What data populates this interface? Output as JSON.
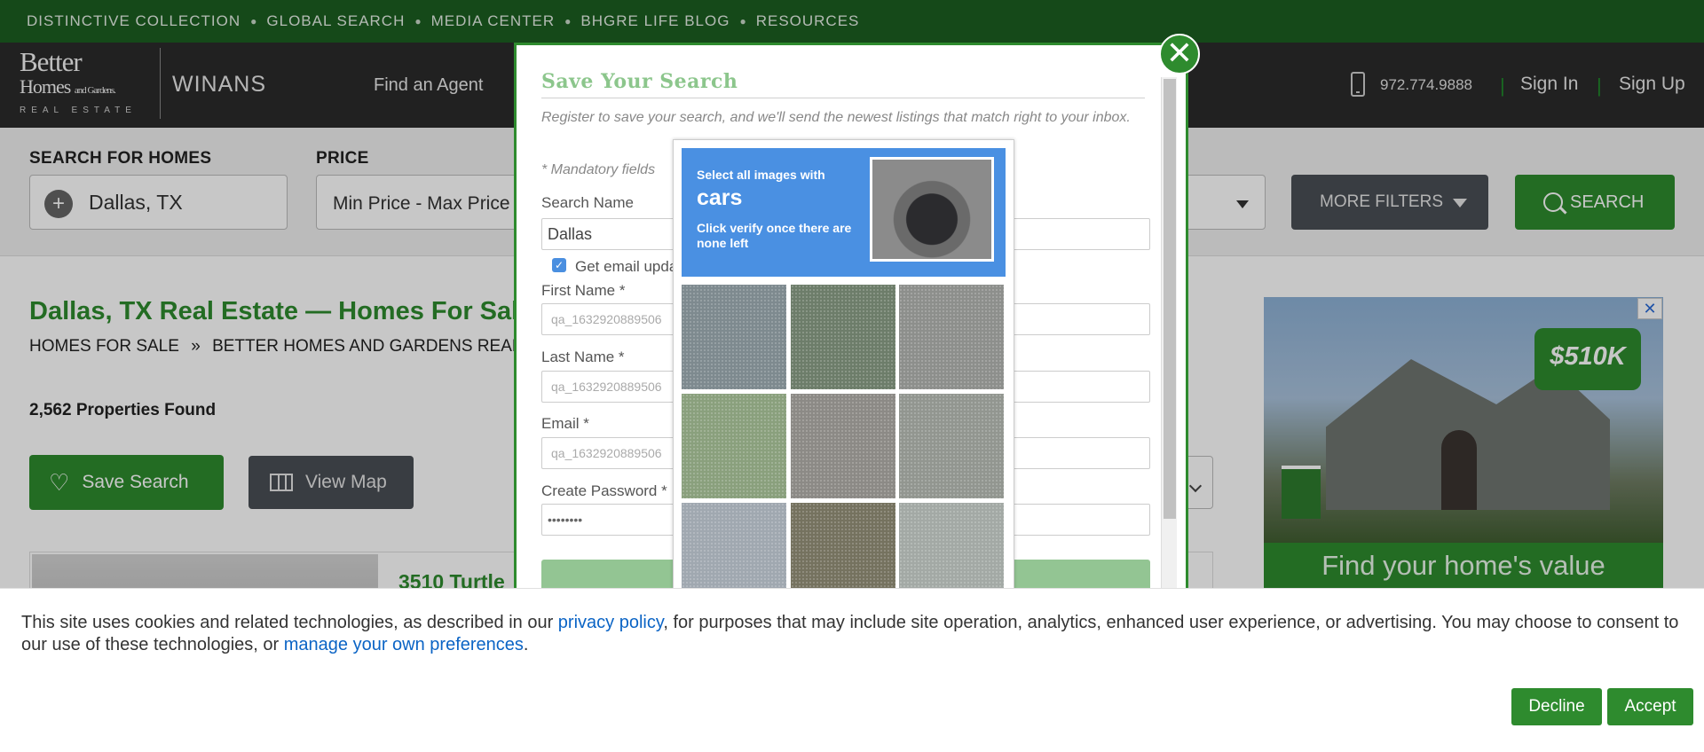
{
  "topbar": {
    "links": [
      "DISTINCTIVE COLLECTION",
      "GLOBAL SEARCH",
      "MEDIA CENTER",
      "BHGRE LIFE BLOG",
      "RESOURCES"
    ]
  },
  "header": {
    "logo_line1": "Better",
    "logo_line2": "Homes and Gardens.",
    "logo_line3": "REAL ESTATE",
    "brand": "WINANS",
    "nav_find_agent": "Find an Agent",
    "phone": "972.774.9888",
    "sign_in": "Sign In",
    "sign_up": "Sign Up"
  },
  "search": {
    "homes_label": "SEARCH FOR HOMES",
    "location": "Dallas, TX",
    "price_label": "PRICE",
    "price_value": "Min Price  -  Max Price",
    "more_filters": "MORE FILTERS",
    "search_button": "SEARCH"
  },
  "page": {
    "title": "Dallas, TX Real Estate — Homes For Sale",
    "breadcrumb": [
      "HOMES FOR SALE",
      "BETTER HOMES AND GARDENS REAL ESTATE"
    ],
    "breadcrumb_sep": "»",
    "count": "2,562 Properties Found",
    "save_search": "Save Search",
    "view_map": "View Map",
    "listing_title": "3510 Turtle"
  },
  "ad": {
    "price": "$510K",
    "cta": "Find your home's value",
    "close": "✕"
  },
  "modal": {
    "title": "Save Your Search",
    "description": "Register to save your search, and we'll send the newest listings that match right to your inbox.",
    "mandatory": "* Mandatory fields",
    "search_name_label": "Search Name",
    "search_name_value": "Dallas",
    "email_updates_label": "Get email updates",
    "first_name_label": "First Name *",
    "first_name_value": "qa_1632920889506",
    "last_name_label": "Last Name *",
    "last_name_value": "qa_1632920889506",
    "email_label": "Email *",
    "email_value": "qa_1632920889506",
    "password_label": "Create Password *",
    "password_value": "••••••••",
    "close": "✕"
  },
  "captcha": {
    "select_all": "Select all images with",
    "target": "cars",
    "instruction": "Click verify once there are none left",
    "tiles": 9
  },
  "cookie": {
    "text_before": "This site uses cookies and related technologies, as described in our ",
    "privacy_link": "privacy policy",
    "text_middle": ", for purposes that may include site operation, analytics, enhanced user experience, or advertising. You may choose to consent to our use of these technologies, or ",
    "preferences_link": "manage your own preferences",
    "text_after": ".",
    "decline": "Decline",
    "accept": "Accept"
  }
}
